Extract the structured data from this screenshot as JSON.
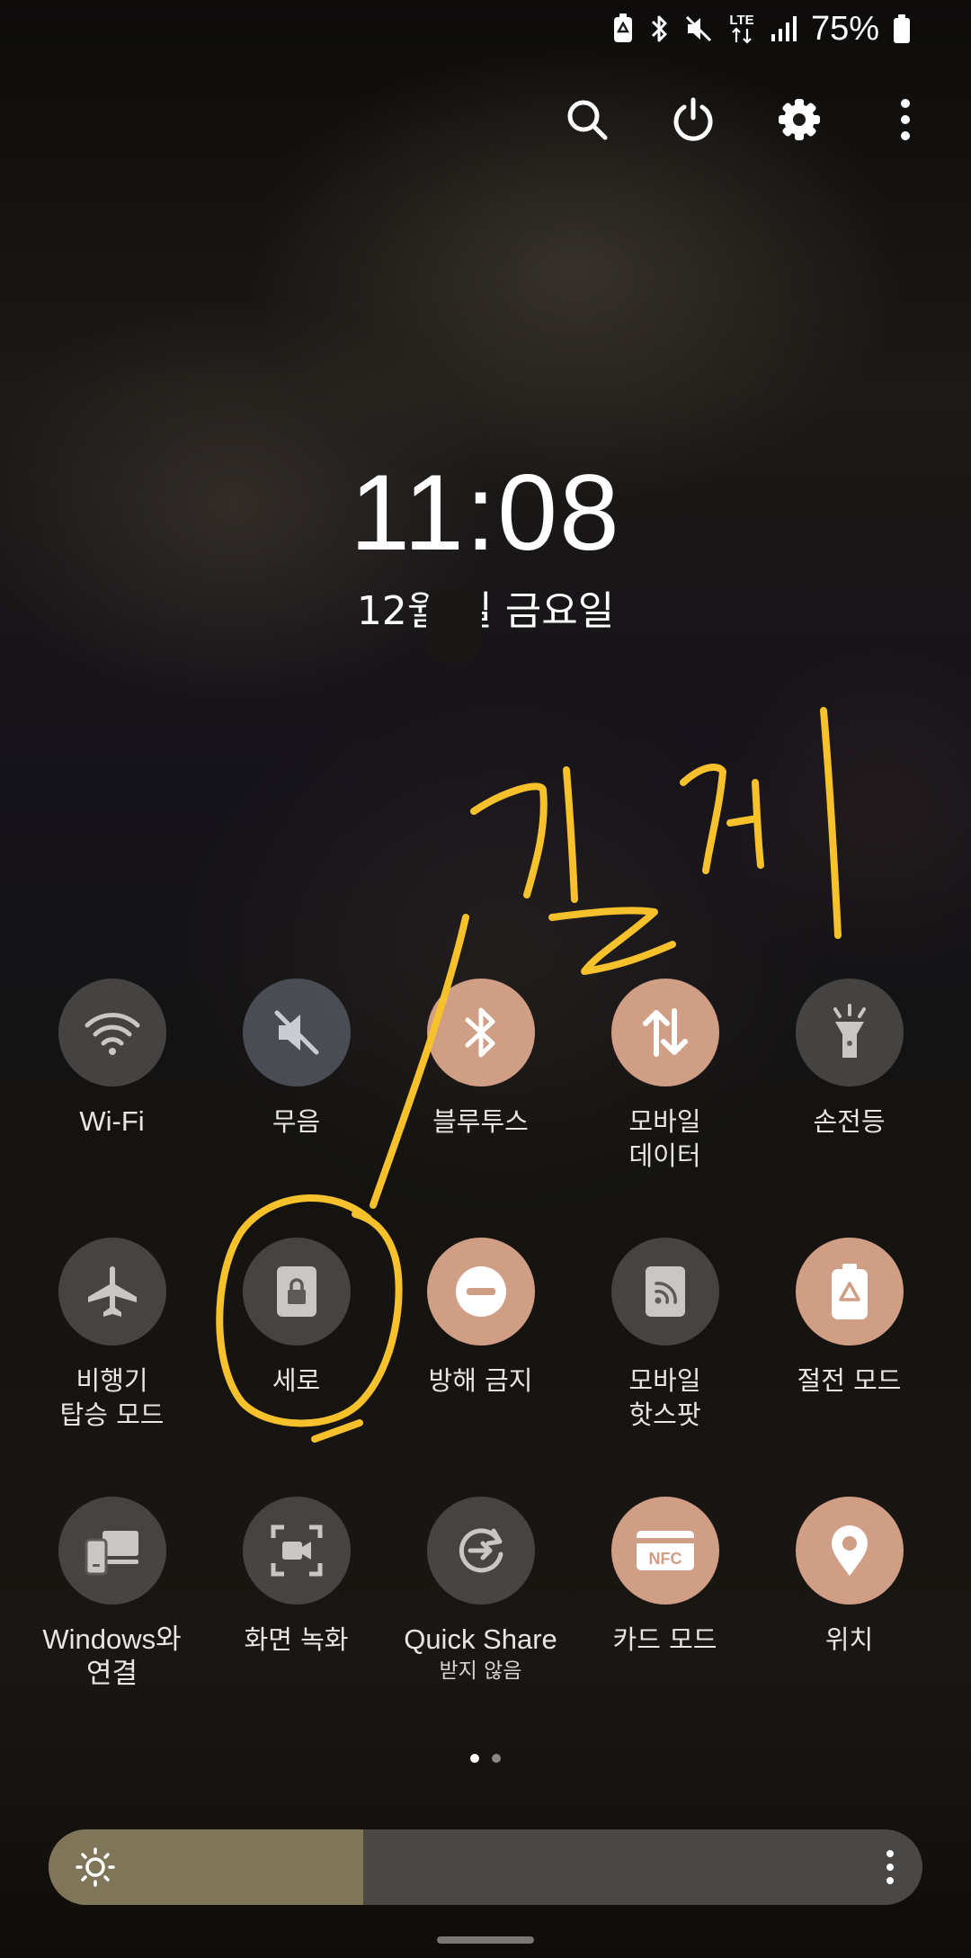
{
  "status_bar": {
    "battery_percent": "75%",
    "icons": [
      "battery-saver-icon",
      "bluetooth-icon",
      "mute-icon",
      "lte-icon",
      "signal-icon",
      "battery-icon"
    ],
    "lte_label": "LTE"
  },
  "top_actions": [
    "search-icon",
    "power-icon",
    "settings-icon",
    "more-options-icon"
  ],
  "clock": {
    "time": "11:08",
    "date": "12월      일 금요일"
  },
  "tiles": [
    {
      "label": "Wi-Fi",
      "icon": "wifi-icon",
      "active": false
    },
    {
      "label": "무음",
      "icon": "mute-icon",
      "active": false
    },
    {
      "label": "블루투스",
      "icon": "bluetooth-icon",
      "active": true
    },
    {
      "label": "모바일\n데이터",
      "icon": "mobile-data-icon",
      "active": true
    },
    {
      "label": "손전등",
      "icon": "flashlight-icon",
      "active": false
    },
    {
      "label": "비행기\n탑승 모드",
      "icon": "airplane-icon",
      "active": false
    },
    {
      "label": "세로",
      "icon": "portrait-lock-icon",
      "active": false
    },
    {
      "label": "방해 금지",
      "icon": "do-not-disturb-icon",
      "active": true
    },
    {
      "label": "모바일\n핫스팟",
      "icon": "hotspot-icon",
      "active": false
    },
    {
      "label": "절전 모드",
      "icon": "power-saving-icon",
      "active": true
    },
    {
      "label": "Windows와\n연결",
      "icon": "link-to-windows-icon",
      "active": false
    },
    {
      "label": "화면 녹화",
      "icon": "screen-recorder-icon",
      "active": false
    },
    {
      "label": "Quick Share",
      "sublabel": "받지 않음",
      "icon": "quick-share-icon",
      "active": false
    },
    {
      "label": "카드 모드",
      "icon": "nfc-icon",
      "active": true,
      "badge": "NFC"
    },
    {
      "label": "위치",
      "icon": "location-icon",
      "active": true
    }
  ],
  "pager": {
    "current": 1,
    "total": 2
  },
  "brightness": {
    "level": 0.36
  },
  "handwriting": {
    "text": "길게"
  },
  "colors": {
    "active_tile": "#d09d85",
    "inactive_tile": "#6e6c68",
    "brightness_fill": "#7f7659",
    "annotation": "#f6c12a"
  }
}
